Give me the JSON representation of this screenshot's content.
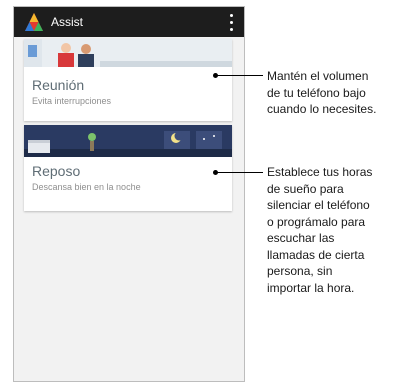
{
  "app": {
    "title": "Assist"
  },
  "cards": [
    {
      "title": "Reunión",
      "subtitle": "Evita interrupciones"
    },
    {
      "title": "Reposo",
      "subtitle": "Descansa bien en la noche"
    }
  ],
  "callouts": [
    "Mantén el volumen\nde tu teléfono bajo\ncuando lo necesites.",
    "Establece tus horas\nde sueño para\nsilenciar el teléfono\no prográmalo para\nescuchar las\nllamadas de cierta\npersona, sin\nimportar la hora."
  ],
  "colors": {
    "appbar": "#1d1d1d",
    "card_title": "#5f6d75",
    "card_subtitle": "#8f8f8f",
    "night_banner": "#2a3a62"
  }
}
